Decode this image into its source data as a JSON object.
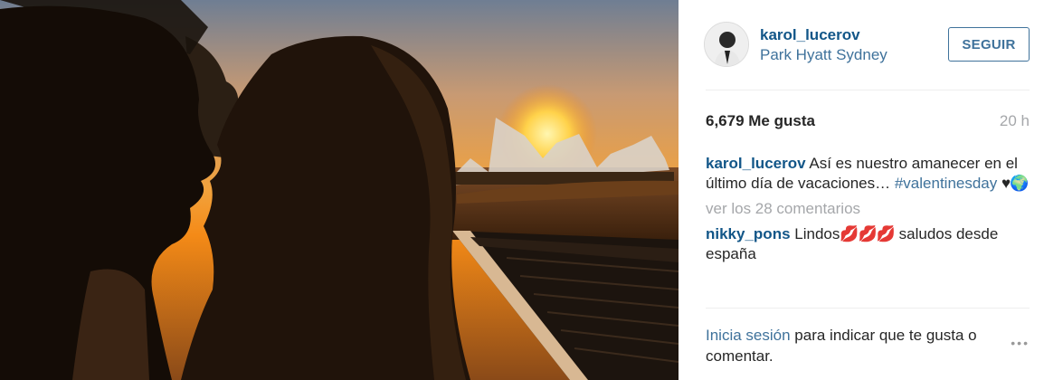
{
  "post": {
    "username": "karol_lucerov",
    "location": "Park Hyatt Sydney",
    "follow_label": "SEGUIR",
    "likes": "6,679 Me gusta",
    "time": "20 h"
  },
  "caption": {
    "username": "karol_lucerov",
    "text": "Así es nuestro amanecer en el último día de vacaciones…",
    "hashtag": "#valentinesday",
    "emoji": "♥🌍"
  },
  "view_comments_label": "ver los 28 comentarios",
  "comments": [
    {
      "username": "nikky_pons",
      "text_start": "Lindos",
      "emoji": "💋💋💋",
      "text_end": "saludos desde españa"
    }
  ],
  "footer": {
    "login_label": "Inicia sesión",
    "login_text": "para indicar que te gusta o comentar.",
    "more_icon": "•••"
  },
  "colors": {
    "link_dark": "#125688",
    "link": "#3f729b",
    "muted": "#a5a7aa",
    "text": "#262626"
  }
}
